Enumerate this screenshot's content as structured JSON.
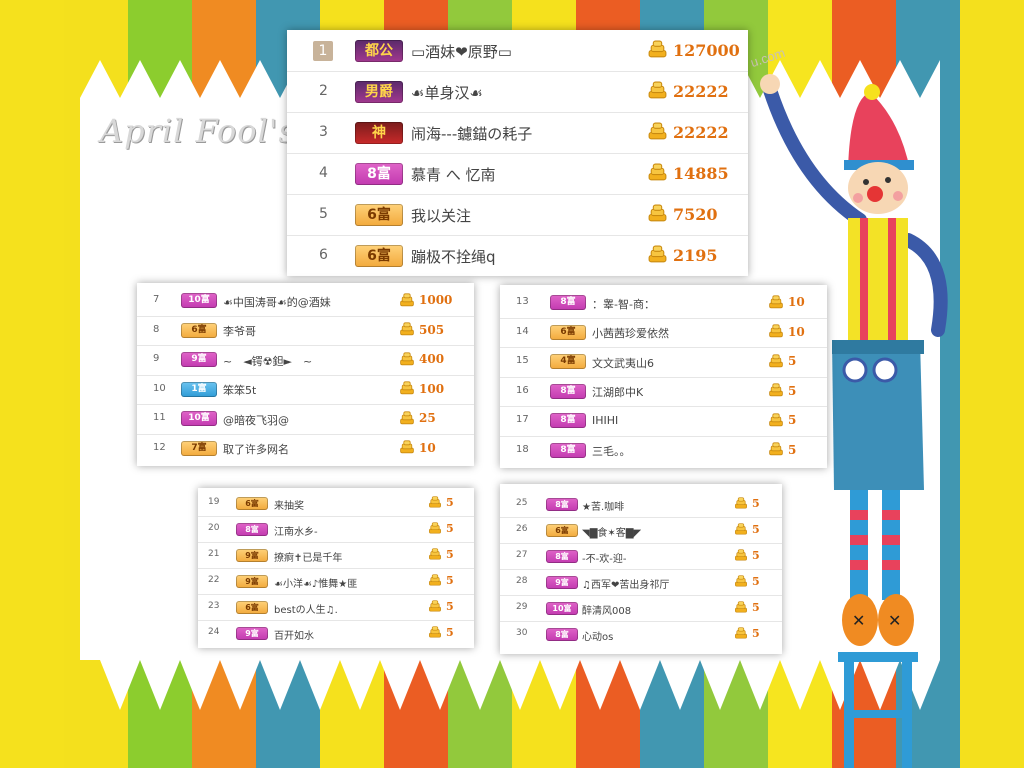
{
  "title": "April  Fool's",
  "watermark": "u.com",
  "colors": {
    "stripes": [
      "#f5e11d",
      "#f4e01d",
      "#8ccd2e",
      "#f08b22",
      "#4197b1",
      "#f5e11d",
      "#eb5d23",
      "#92c93c",
      "#f5e11d",
      "#eb5d23",
      "#4197b1",
      "#92c93c",
      "#f6e51f",
      "#eb5d23",
      "#4197b1",
      "#f4e01d"
    ],
    "score": "#e07010",
    "badge_pink": "#c23ab0",
    "badge_orange": "#f2a93c",
    "badge_blue": "#2f9bd6"
  },
  "panels": [
    {
      "id": "panel-top",
      "rows": [
        {
          "rank": "1",
          "badge": "都公",
          "badge_style": "gold",
          "name": "▭酒妹❤原野▭",
          "score": "127000"
        },
        {
          "rank": "2",
          "badge": "男爵",
          "badge_style": "gold",
          "name": "☙单身汉☙",
          "score": "22222"
        },
        {
          "rank": "3",
          "badge": "神",
          "badge_style": "red",
          "name": "闹海---鑢錨の耗子",
          "score": "22222"
        },
        {
          "rank": "4",
          "badge": "8富",
          "badge_style": "pink",
          "name": "慕青 へ 忆南",
          "score": "14885"
        },
        {
          "rank": "5",
          "badge": "6富",
          "badge_style": "orange",
          "name": "我以关注",
          "score": "7520"
        },
        {
          "rank": "6",
          "badge": "6富",
          "badge_style": "orange",
          "name": "蹦极不拴绳q",
          "score": "2195"
        }
      ]
    },
    {
      "id": "panel-mid-left",
      "rows": [
        {
          "rank": "7",
          "badge": "10富",
          "badge_style": "pink",
          "name": "☙中国涛哥☙的@酒妹",
          "score": "1000"
        },
        {
          "rank": "8",
          "badge": "6富",
          "badge_style": "orange",
          "name": "李爷哥",
          "score": "505"
        },
        {
          "rank": "9",
          "badge": "9富",
          "badge_style": "pink",
          "name": "~　◄锷☢鉭►　~",
          "score": "400"
        },
        {
          "rank": "10",
          "badge": "1富",
          "badge_style": "blue",
          "name": "笨笨5t",
          "score": "100"
        },
        {
          "rank": "11",
          "badge": "10富",
          "badge_style": "pink",
          "name": "@暗夜飞羽@",
          "score": "25"
        },
        {
          "rank": "12",
          "badge": "7富",
          "badge_style": "orange",
          "name": "取了许多网名",
          "score": "10"
        }
      ]
    },
    {
      "id": "panel-mid-right",
      "rows": [
        {
          "rank": "13",
          "badge": "8富",
          "badge_style": "pink",
          "name": "：睾-智-商：",
          "score": "10"
        },
        {
          "rank": "14",
          "badge": "6富",
          "badge_style": "orange",
          "name": "小茜茜珍爱依然",
          "score": "10"
        },
        {
          "rank": "15",
          "badge": "4富",
          "badge_style": "orange",
          "name": "文文武夷山6",
          "score": "5"
        },
        {
          "rank": "16",
          "badge": "8富",
          "badge_style": "pink",
          "name": "江湖郎中K",
          "score": "5"
        },
        {
          "rank": "17",
          "badge": "8富",
          "badge_style": "pink",
          "name": "IHIHI",
          "score": "5"
        },
        {
          "rank": "18",
          "badge": "8富",
          "badge_style": "pink",
          "name": "三毛。。",
          "score": "5"
        }
      ]
    },
    {
      "id": "panel-bottom-left",
      "rows": [
        {
          "rank": "19",
          "badge": "6富",
          "badge_style": "orange",
          "name": "来抽奖",
          "score": "5"
        },
        {
          "rank": "20",
          "badge": "8富",
          "badge_style": "pink",
          "name": "江南水乡-",
          "score": "5"
        },
        {
          "rank": "21",
          "badge": "9富",
          "badge_style": "orange",
          "name": "撩痾✝已是千年",
          "score": "5"
        },
        {
          "rank": "22",
          "badge": "9富",
          "badge_style": "orange",
          "name": "☙小洋☙♪惟舞★匪",
          "score": "5"
        },
        {
          "rank": "23",
          "badge": "6富",
          "badge_style": "orange",
          "name": "bestの人生♫.",
          "score": "5"
        },
        {
          "rank": "24",
          "badge": "9富",
          "badge_style": "pink",
          "name": "百开如水",
          "score": "5"
        }
      ]
    },
    {
      "id": "panel-bottom-right",
      "rows": [
        {
          "rank": "25",
          "badge": "8富",
          "badge_style": "pink",
          "name": "★苦.咖啡",
          "score": "5"
        },
        {
          "rank": "26",
          "badge": "6富",
          "badge_style": "orange",
          "name": "◥▇食✶客▇◤",
          "score": "5"
        },
        {
          "rank": "27",
          "badge": "8富",
          "badge_style": "pink",
          "name": "-不-欢-迎-",
          "score": "5"
        },
        {
          "rank": "28",
          "badge": "9富",
          "badge_style": "pink",
          "name": "♫西军❤苦出身祁厅",
          "score": "5"
        },
        {
          "rank": "29",
          "badge": "10富",
          "badge_style": "pink",
          "name": "醉清风008",
          "score": "5"
        },
        {
          "rank": "30",
          "badge": "8富",
          "badge_style": "pink",
          "name": "心动os",
          "score": "5"
        }
      ]
    }
  ]
}
